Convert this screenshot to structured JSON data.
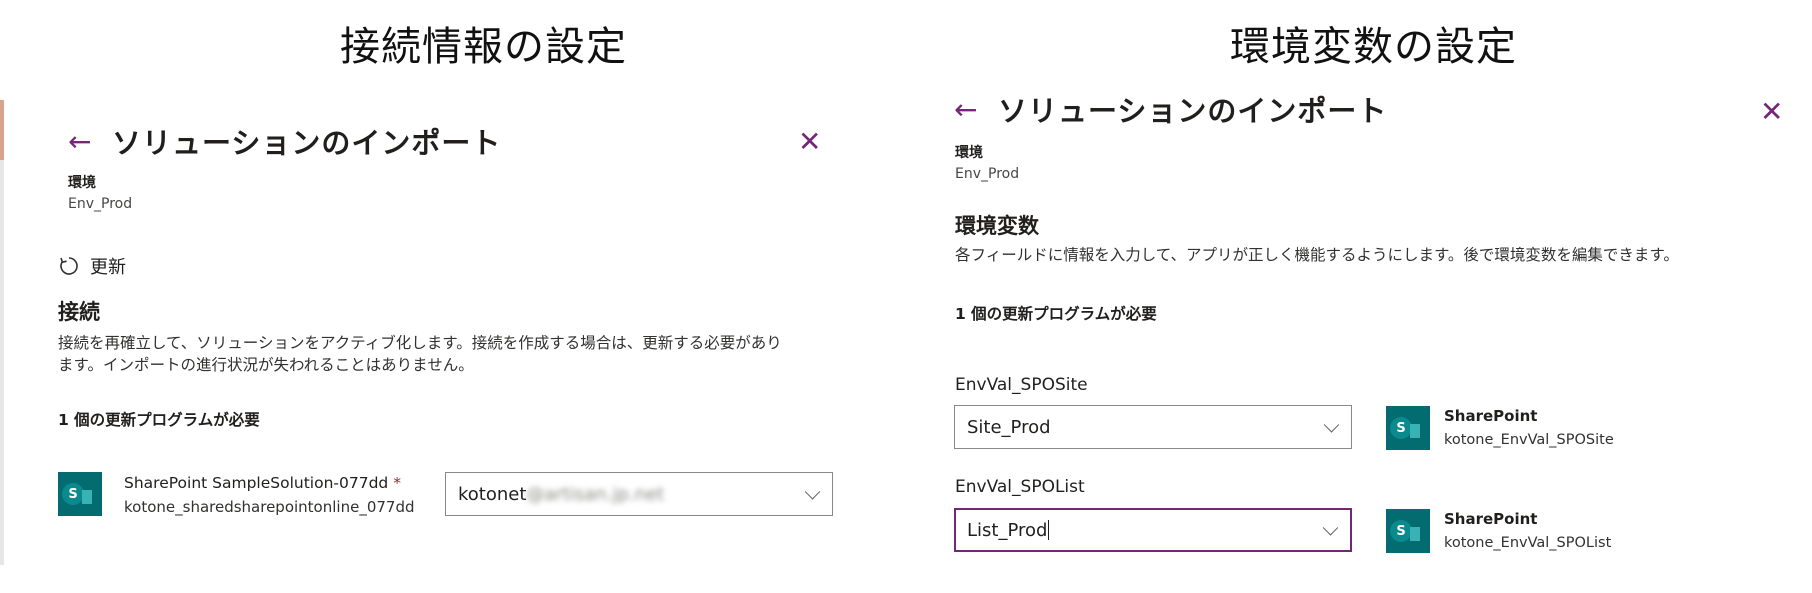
{
  "headings": {
    "left": "接続情報の設定",
    "right": "環境変数の設定"
  },
  "left_panel": {
    "title": "ソリューションのインポート",
    "environment_label": "環境",
    "environment_value": "Env_Prod",
    "refresh_label": "更新",
    "section_title": "接続",
    "description_line1": "接続を再確立して、ソリューションをアクティブ化します。接続を作成する場合は、更新する必要があり",
    "description_line2": "ます。インポートの進行状況が失われることはありません。",
    "requirement": "1 個の更新プログラムが必要",
    "connection": {
      "name": "SharePoint SampleSolution-077dd",
      "required_mark": "*",
      "sub": "kotone_sharedsharepointonline_077dd",
      "dropdown_value_visible": "kotonet",
      "dropdown_value_blurred": "@artisan.jp.net"
    }
  },
  "right_panel": {
    "title": "ソリューションのインポート",
    "environment_label": "環境",
    "environment_value": "Env_Prod",
    "section_title": "環境変数",
    "description": "各フィールドに情報を入力して、アプリが正しく機能するようにします。後で環境変数を編集できます。",
    "requirement": "1 個の更新プログラムが必要",
    "variables": [
      {
        "label": "EnvVal_SPOSite",
        "value": "Site_Prod",
        "connector_name": "SharePoint",
        "connector_sub": "kotone_EnvVal_SPOSite"
      },
      {
        "label": "EnvVal_SPOList",
        "value": "List_Prod",
        "connector_name": "SharePoint",
        "connector_sub": "kotone_EnvVal_SPOList"
      }
    ]
  },
  "icons": {
    "back": "back-arrow-icon",
    "close": "close-icon",
    "refresh": "refresh-icon",
    "sharepoint": "sharepoint-icon",
    "chevron": "chevron-down-icon"
  },
  "colors": {
    "accent": "#742774",
    "sharepoint": "#036c70",
    "required": "#a4262c"
  }
}
